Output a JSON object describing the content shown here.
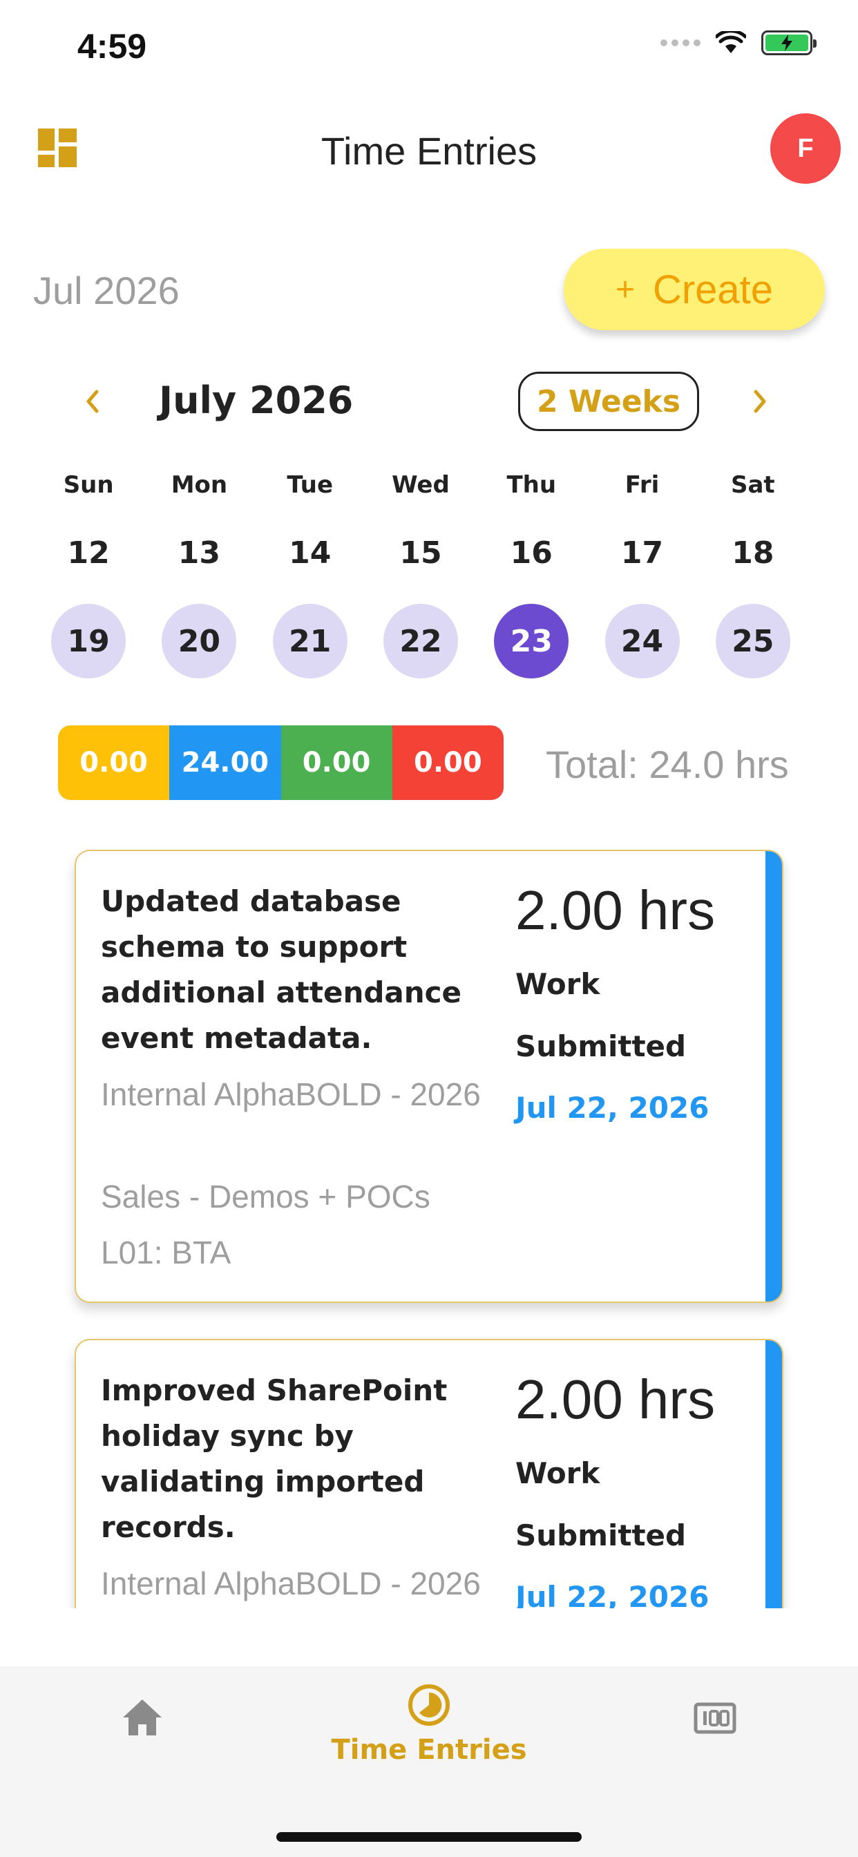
{
  "status_bar": {
    "time": "4:59"
  },
  "header": {
    "title": "Time Entries",
    "avatar_initial": "F"
  },
  "period_label": "Jul 2026",
  "create_button": {
    "label": "Create"
  },
  "calendar": {
    "title": "July 2026",
    "view_mode": "2 Weeks",
    "weekdays": [
      "Sun",
      "Mon",
      "Tue",
      "Wed",
      "Thu",
      "Fri",
      "Sat"
    ],
    "week1": [
      "12",
      "13",
      "14",
      "15",
      "16",
      "17",
      "18"
    ],
    "week2": [
      "19",
      "20",
      "21",
      "22",
      "23",
      "24",
      "25"
    ],
    "selected_day": "23"
  },
  "summary": {
    "segments": [
      "0.00",
      "24.00",
      "0.00",
      "0.00"
    ],
    "total": "Total: 24.0 hrs"
  },
  "entries": [
    {
      "description": "Updated database schema to support additional attendance event metadata.",
      "project": "Internal AlphaBOLD - 2026",
      "task": "Sales - Demos + POCs",
      "category": "L01: BTA",
      "hours": "2.00 hrs",
      "type": "Work",
      "status": "Submitted",
      "date": "Jul 22, 2026"
    },
    {
      "description": "Improved SharePoint holiday sync by validating imported records.",
      "project": "Internal AlphaBOLD - 2026",
      "hours": "2.00 hrs",
      "type": "Work",
      "status": "Submitted",
      "date": "Jul 22, 2026"
    }
  ],
  "bottom_nav": {
    "active_label": "Time Entries"
  },
  "colors": {
    "accent": "#d4a017",
    "create_bg": "#fff176",
    "selected_day": "#6c4bd1",
    "day_chip": "#ddd9f4",
    "avatar": "#f44a4a",
    "entry_stripe": "#2196f3"
  },
  "icons": [
    "dashboard-icon",
    "home-icon",
    "clock-icon",
    "counter-icon",
    "wifi-icon",
    "battery-icon"
  ]
}
